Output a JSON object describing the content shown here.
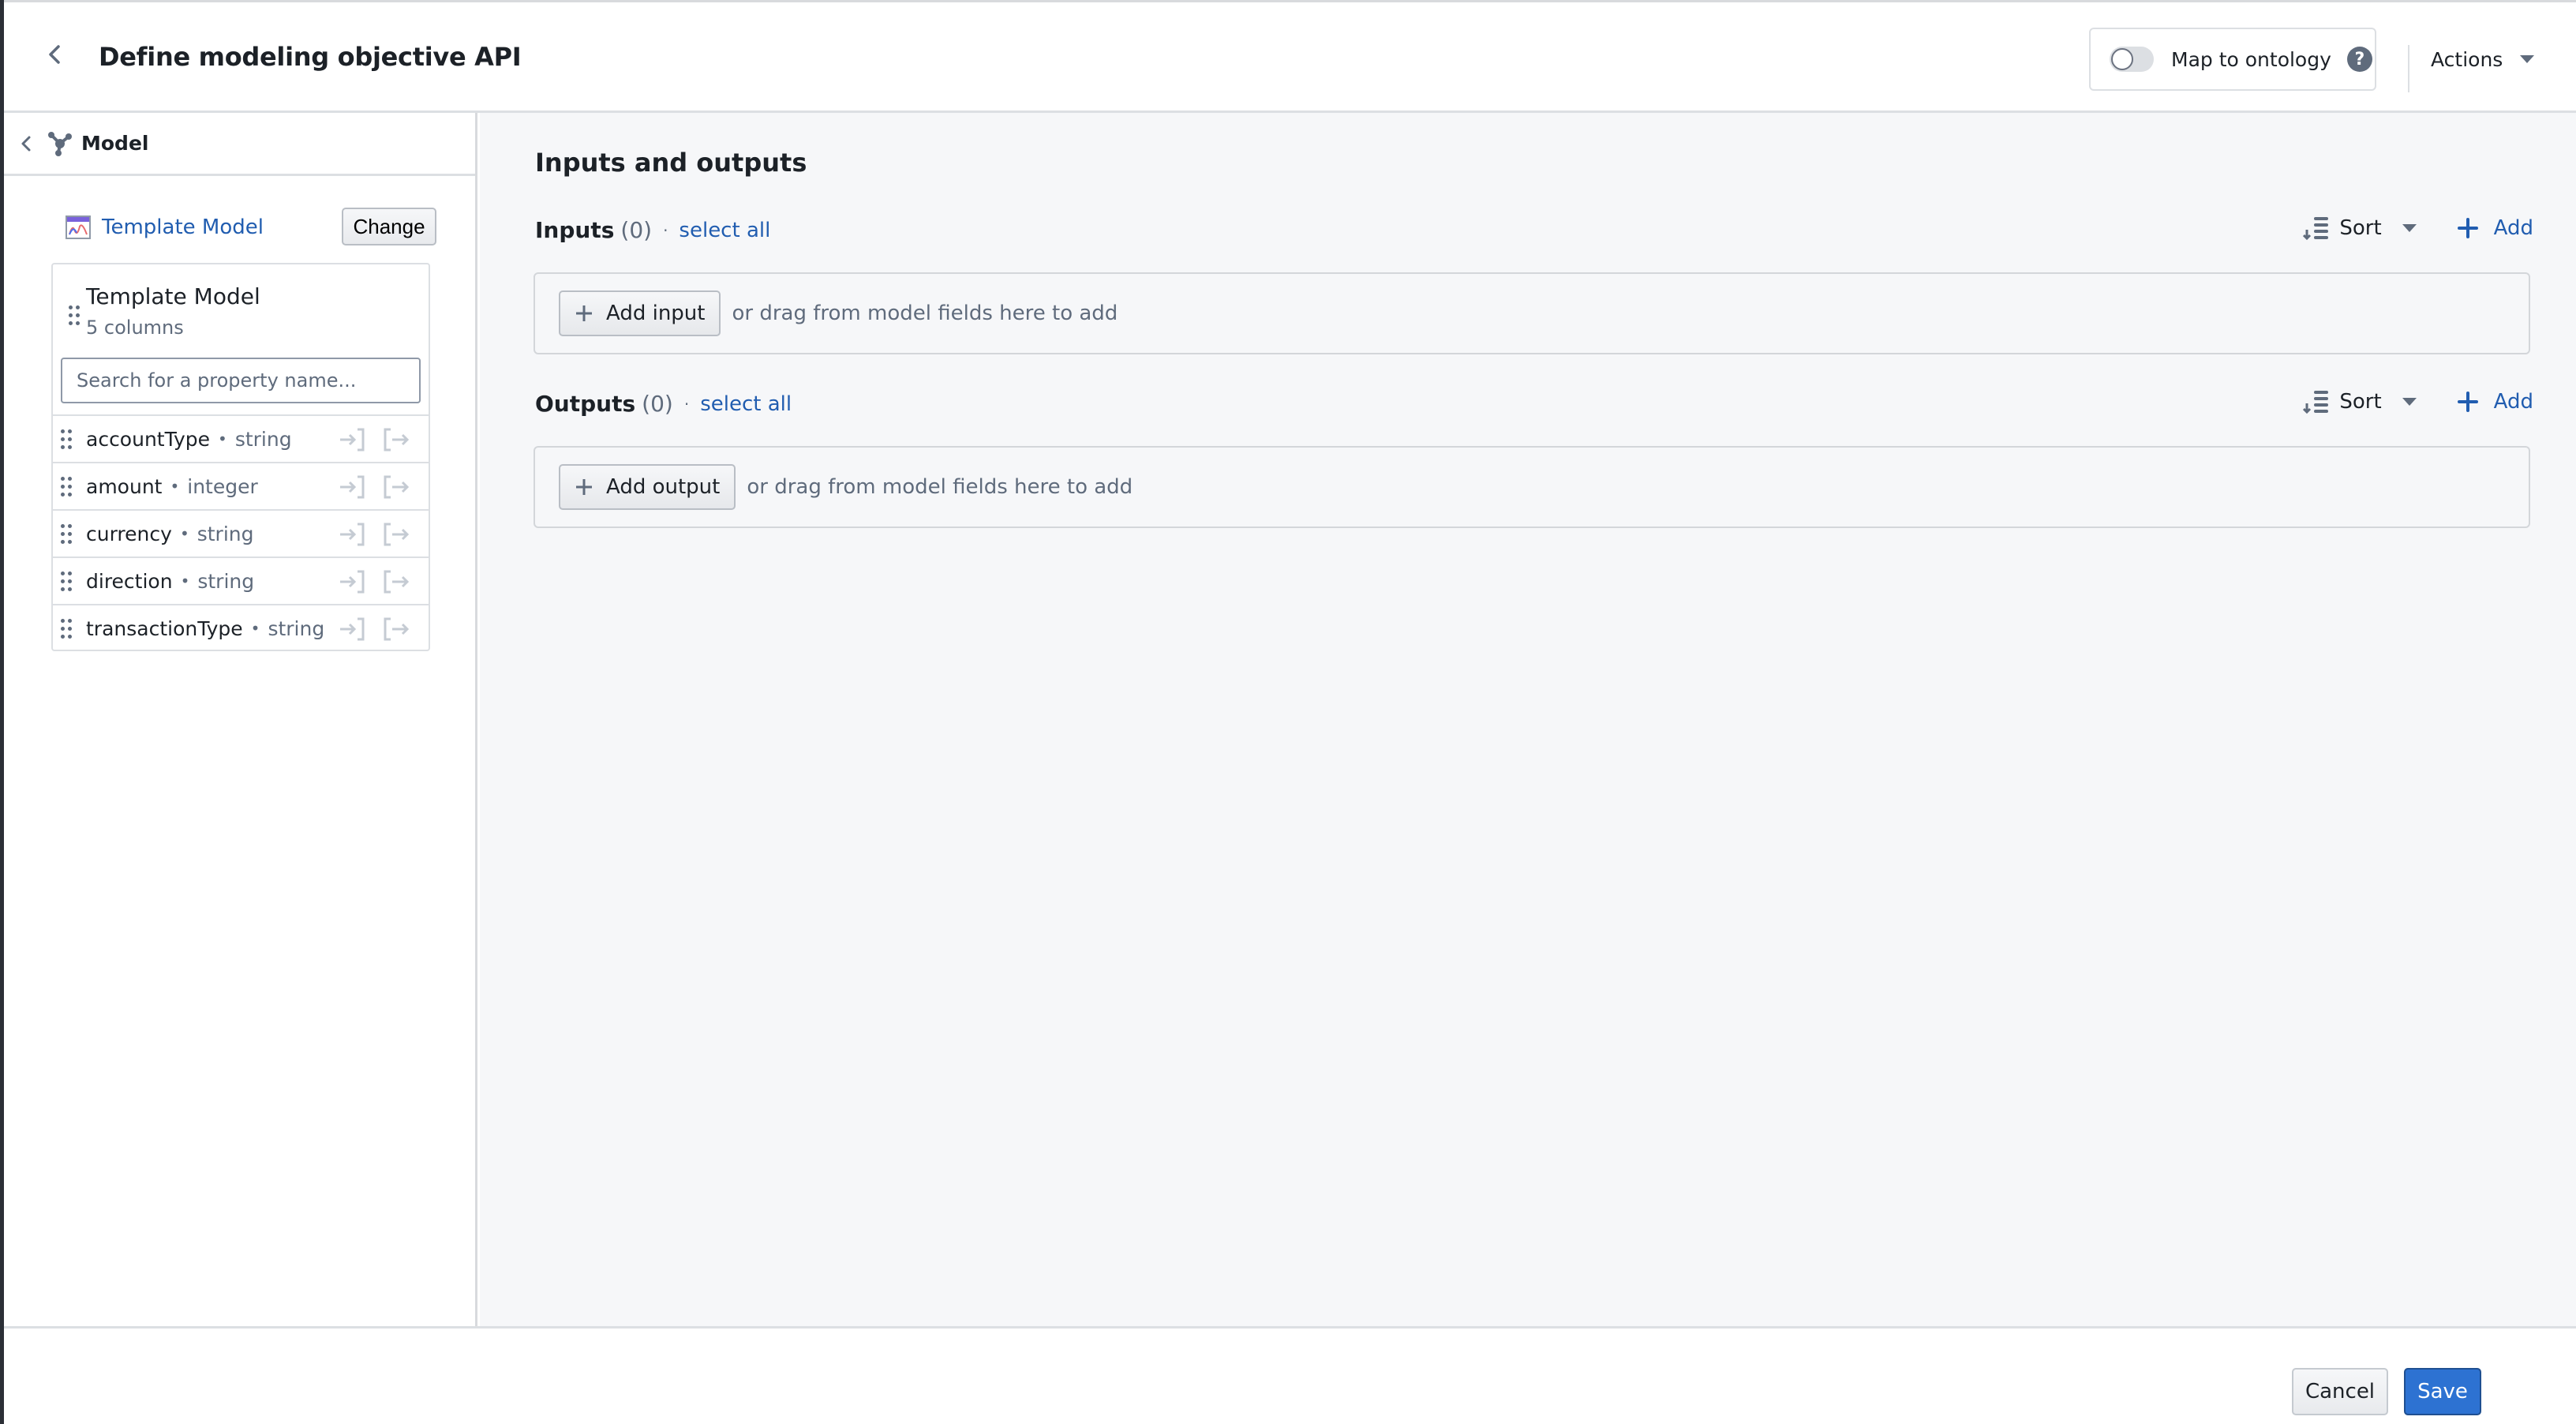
{
  "header": {
    "title": "Define modeling objective API",
    "map_to_ontology_label": "Map to ontology",
    "map_to_ontology_enabled": false,
    "help_glyph": "?",
    "actions_label": "Actions"
  },
  "sidebar": {
    "section_label": "Model",
    "model_link": "Template Model",
    "change_label": "Change",
    "card": {
      "title": "Template Model",
      "subtitle": "5 columns",
      "search_placeholder": "Search for a property name...",
      "search_value": ""
    },
    "fields": [
      {
        "name": "accountType",
        "type": "string"
      },
      {
        "name": "amount",
        "type": "integer"
      },
      {
        "name": "currency",
        "type": "string"
      },
      {
        "name": "direction",
        "type": "string"
      },
      {
        "name": "transactionType",
        "type": "string"
      }
    ],
    "separator": "•"
  },
  "main": {
    "title": "Inputs and outputs",
    "inputs": {
      "label": "Inputs",
      "count": "(0)",
      "sep": "·",
      "select_all": "select all",
      "sort_label": "Sort",
      "add_label": "Add",
      "add_button": "Add input",
      "hint": "or drag from model fields here to add"
    },
    "outputs": {
      "label": "Outputs",
      "count": "(0)",
      "sep": "·",
      "select_all": "select all",
      "sort_label": "Sort",
      "add_label": "Add",
      "add_button": "Add output",
      "hint": "or drag from model fields here to add"
    }
  },
  "footer": {
    "cancel_label": "Cancel",
    "save_label": "Save"
  },
  "colors": {
    "accent": "#2d72d2",
    "link": "#215db0",
    "muted": "#5f6b7c",
    "background": "#f6f7f9"
  }
}
